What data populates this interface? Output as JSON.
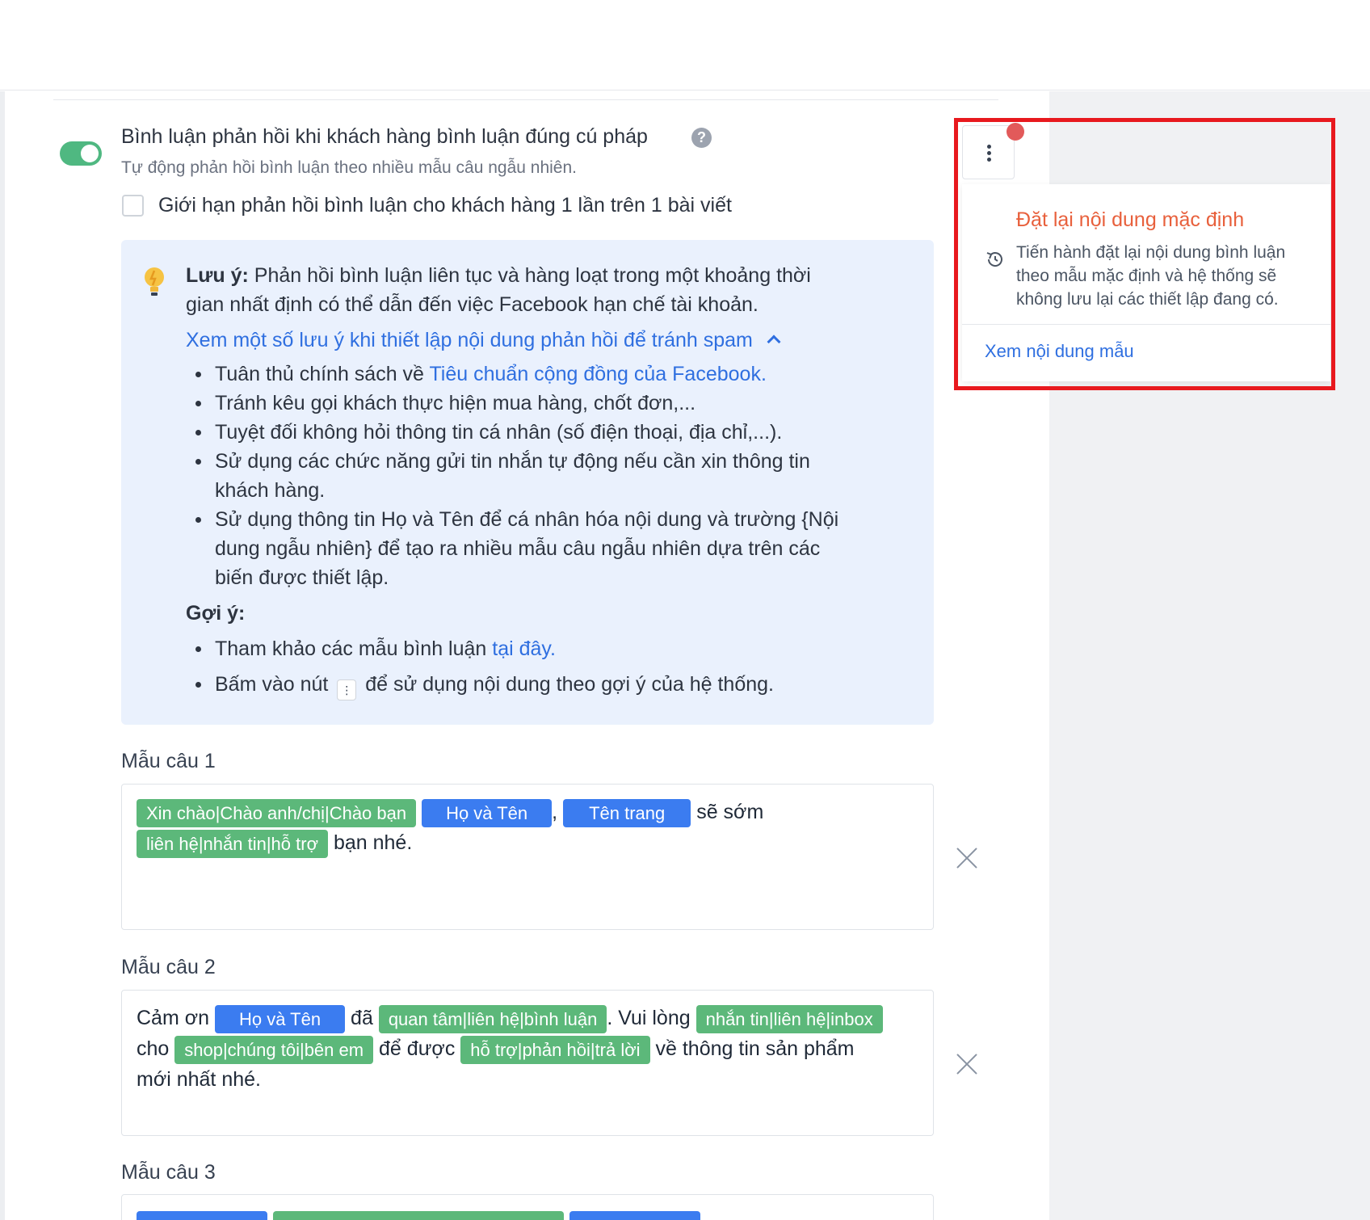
{
  "setting": {
    "title": "Bình luận phản hồi khi khách hàng bình luận đúng cú pháp",
    "subtitle": "Tự động phản hồi bình luận theo nhiều mẫu câu ngẫu nhiên.",
    "help_icon": "?",
    "enabled": true,
    "limit_checkbox_label": "Giới hạn phản hồi bình luận cho khách hàng 1 lần trên 1 bài viết",
    "limit_checked": false
  },
  "note": {
    "label": "Lưu ý:",
    "line1": " Phản hồi bình luận liên tục và hàng loạt trong một khoảng thời",
    "line2": "gian nhất định có thể dẫn đến việc Facebook hạn chế tài khoản.",
    "spam_tips_link": "Xem một số lưu ý khi thiết lập nội dung phản hồi để tránh spam",
    "tip1_prefix": "Tuân thủ chính sách về ",
    "tip1_link": "Tiêu chuẩn cộng đồng của Facebook.",
    "tip2": "Tránh kêu gọi khách thực hiện mua hàng, chốt đơn,...",
    "tip3": "Tuyệt đối không hỏi thông tin cá nhân (số điện thoại, địa chỉ,...).",
    "tip4": "Sử dụng các chức năng gửi tin nhắn tự động nếu cần xin thông tin khách hàng.",
    "tip5": "Sử dụng thông tin Họ và Tên để cá nhân hóa nội dung và trường {Nội dung ngẫu nhiên} để tạo ra nhiều mẫu câu ngẫu nhiên dựa trên các biến được thiết lập.",
    "hint_label": "Gợi ý:",
    "hint1_prefix": "Tham khảo các mẫu bình luận ",
    "hint1_link": "tại đây.",
    "hint2_prefix": "Bấm vào nút",
    "hint2_suffix": "để sử dụng nội dung theo gợi ý của hệ thống."
  },
  "samples": [
    {
      "label": "Mẫu câu 1",
      "line1": {
        "chip1": "Xin chào|Chào anh/chị|Chào bạn",
        "chip2": "Họ và Tên",
        "sep": ",",
        "chip3": "Tên trang",
        "text": "sẽ sớm"
      },
      "line2": {
        "chip1": "liên hệ|nhắn tin|hỗ trợ",
        "text": "bạn nhé."
      }
    },
    {
      "label": "Mẫu câu 2",
      "line1": {
        "text1": "Cảm ơn",
        "chip1": "Họ và Tên",
        "text2": "đã",
        "chip2": "quan tâm|liên hệ|bình luận",
        "text3": ". Vui lòng",
        "chip3": "nhắn tin|liên hệ|inbox"
      },
      "line2": {
        "text1": "cho",
        "chip1": "shop|chúng tôi|bên em",
        "text2": "để được",
        "chip2": "hỗ trợ|phản hồi|trả lời",
        "text3": "về thông tin sản phẩm"
      },
      "line3": "mới nhất nhé."
    },
    {
      "label": "Mẫu câu 3"
    }
  ],
  "menu": {
    "reset_title": "Đặt lại nội dung mặc định",
    "reset_description": "Tiến hành đặt lại nội dung bình luận theo mẫu mặc định và hệ thống sẽ không lưu lại các thiết lập đang có.",
    "view_sample": "Xem nội dung mẫu"
  },
  "colors": {
    "accent_blue": "#2f6fe0",
    "chip_blue": "#3b7cf0",
    "chip_green": "#5cb87a",
    "toggle_green": "#4fb881",
    "reset_orange": "#e8603c",
    "highlight_red": "#e8191e"
  },
  "icons": [
    "help-icon",
    "lightbulb-icon",
    "chevron-up-icon",
    "kebab-menu-icon",
    "close-icon",
    "reset-icon"
  ]
}
